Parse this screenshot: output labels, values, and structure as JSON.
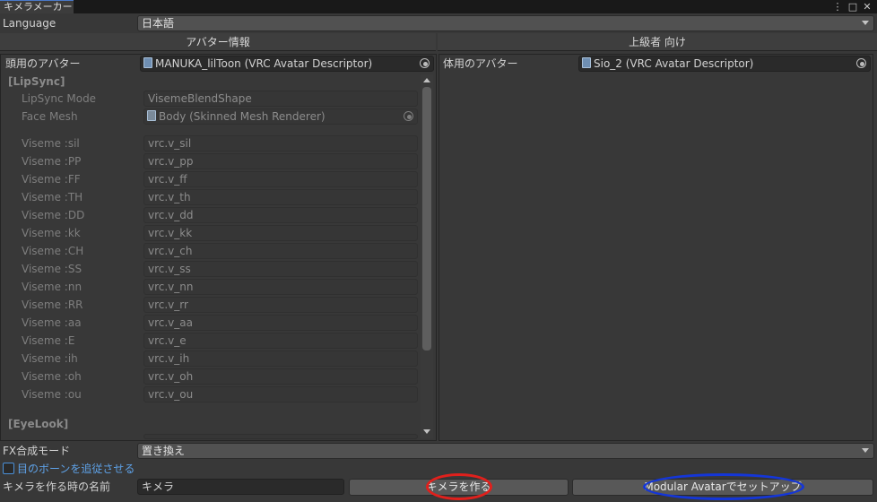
{
  "window": {
    "title": "キメラメーカー",
    "icons": [
      "more-vert-icon",
      "maximize-icon",
      "close-icon"
    ]
  },
  "language": {
    "label": "Language",
    "value": "日本語"
  },
  "tabs": {
    "left": "アバター情報",
    "right": "上級者 向け"
  },
  "left_panel": {
    "head_avatar": {
      "label": "頭用のアバター",
      "value": "MANUKA_lilToon (VRC Avatar Descriptor)"
    },
    "lipsync_section": "[LipSync]",
    "lipsync_mode": {
      "label": "LipSync Mode",
      "value": "VisemeBlendShape"
    },
    "face_mesh": {
      "label": "Face Mesh",
      "value": "Body (Skinned Mesh Renderer)"
    },
    "visemes": [
      {
        "label": "Viseme :sil",
        "value": "vrc.v_sil"
      },
      {
        "label": "Viseme :PP",
        "value": "vrc.v_pp"
      },
      {
        "label": "Viseme :FF",
        "value": "vrc.v_ff"
      },
      {
        "label": "Viseme :TH",
        "value": "vrc.v_th"
      },
      {
        "label": "Viseme :DD",
        "value": "vrc.v_dd"
      },
      {
        "label": "Viseme :kk",
        "value": "vrc.v_kk"
      },
      {
        "label": "Viseme :CH",
        "value": "vrc.v_ch"
      },
      {
        "label": "Viseme :SS",
        "value": "vrc.v_ss"
      },
      {
        "label": "Viseme :nn",
        "value": "vrc.v_nn"
      },
      {
        "label": "Viseme :RR",
        "value": "vrc.v_rr"
      },
      {
        "label": "Viseme :aa",
        "value": "vrc.v_aa"
      },
      {
        "label": "Viseme :E",
        "value": "vrc.v_e"
      },
      {
        "label": "Viseme :ih",
        "value": "vrc.v_ih"
      },
      {
        "label": "Viseme :oh",
        "value": "vrc.v_oh"
      },
      {
        "label": "Viseme :ou",
        "value": "vrc.v_ou"
      }
    ],
    "eyelook_section": "[EyeLook]"
  },
  "right_panel": {
    "body_avatar": {
      "label": "体用のアバター",
      "value": "Sio_2 (VRC Avatar Descriptor)"
    }
  },
  "fx_mode": {
    "label": "FX合成モード",
    "value": "置き換え"
  },
  "follow_eye_bone": {
    "label": "目のボーンを追従させる",
    "checked": false
  },
  "chimera_name": {
    "label": "キメラを作る時の名前",
    "value": "キメラ"
  },
  "buttons": {
    "create": "キメラを作る",
    "modular": "Modular Avatarでセットアップ"
  },
  "colors": {
    "red_annotation": "#e0201c",
    "blue_annotation": "#1436d8",
    "accent": "#4a90d9"
  }
}
